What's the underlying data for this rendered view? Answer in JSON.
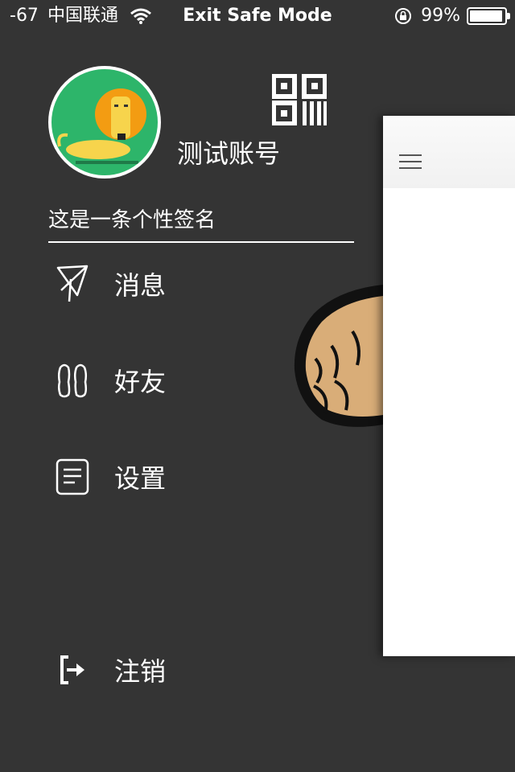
{
  "status_bar": {
    "signal": "-67",
    "carrier": "中国联通",
    "center_text": "Exit Safe Mode",
    "battery_percent": "99%",
    "battery_level": 0.99
  },
  "profile": {
    "username": "测试账号",
    "signature": "这是一条个性签名"
  },
  "menu": [
    {
      "label": "消息",
      "icon": "message-icon"
    },
    {
      "label": "好友",
      "icon": "friends-icon"
    },
    {
      "label": "设置",
      "icon": "settings-icon"
    }
  ],
  "logout": {
    "label": "注销",
    "icon": "logout-icon"
  },
  "colors": {
    "background": "#343434",
    "avatar_bg": "#2db56a",
    "lion": "#f39c12"
  }
}
